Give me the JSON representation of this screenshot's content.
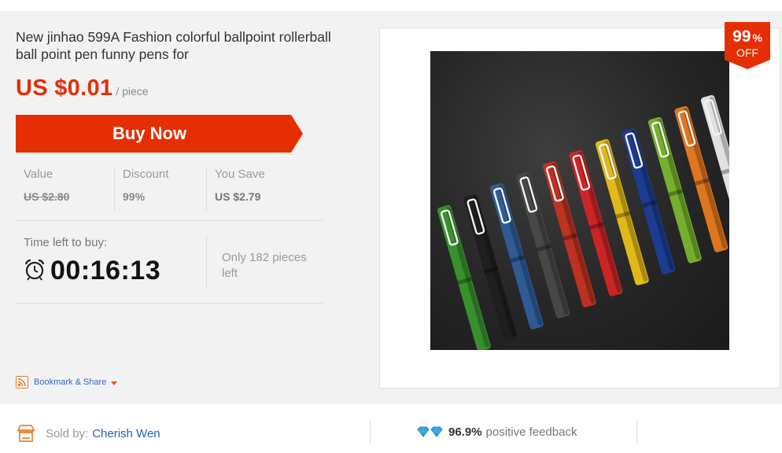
{
  "product": {
    "title": "New jinhao 599A Fashion colorful ballpoint rollerball ball point pen funny pens for",
    "price": "US $0.01",
    "unit": "/ piece",
    "buy_label": "Buy Now"
  },
  "stats": {
    "value_label": "Value",
    "value": "US $2.80",
    "discount_label": "Discount",
    "discount": "99%",
    "save_label": "You Save",
    "save": "US $2.79"
  },
  "timer": {
    "label": "Time left to buy:",
    "countdown": "00:16:13",
    "stock_text": "Only 182 pieces left"
  },
  "bookmark": {
    "label": "Bookmark & Share"
  },
  "badge": {
    "percent": "99",
    "symbol": "%",
    "off": "OFF"
  },
  "seller": {
    "label": "Sold by:",
    "name": "Cherish Wen"
  },
  "feedback": {
    "value": "96.9%",
    "label": "positive feedback"
  },
  "pens": [
    {
      "color": "#3a9a2e"
    },
    {
      "color": "#1e1e1e"
    },
    {
      "color": "#2f5f9e"
    },
    {
      "color": "#4a4a4a"
    },
    {
      "color": "#c8331f"
    },
    {
      "color": "#d92424"
    },
    {
      "color": "#f0c418"
    },
    {
      "color": "#1a3f9a"
    },
    {
      "color": "#7dbb2e"
    },
    {
      "color": "#f07d1e"
    },
    {
      "color": "#f2f2f2"
    }
  ],
  "colors": {
    "accent": "#e62e04",
    "link": "#2a5db0"
  }
}
